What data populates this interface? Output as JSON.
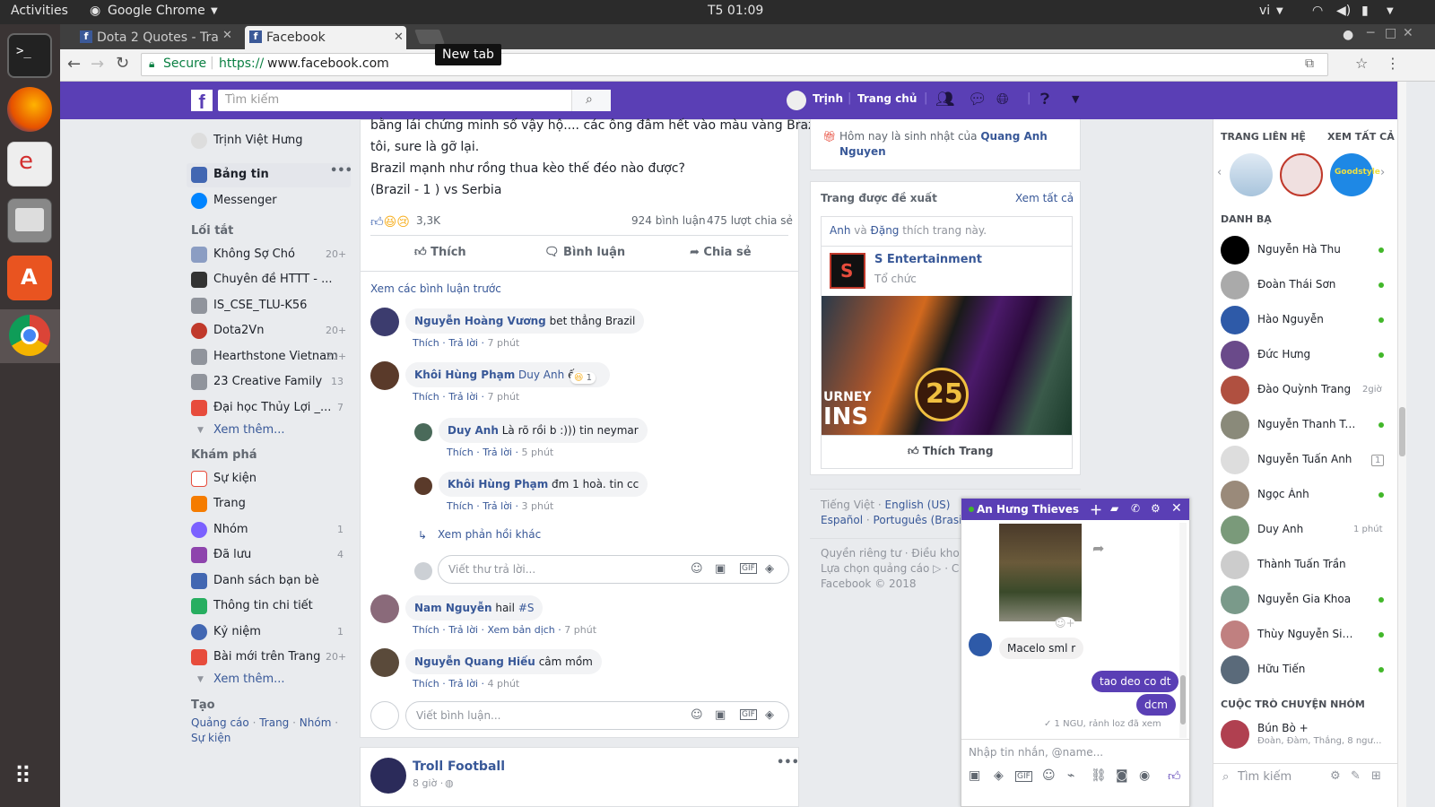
{
  "os": {
    "activities": "Activities",
    "app": "Google Chrome",
    "clock": "T5 01:09",
    "lang": "vi"
  },
  "chrome": {
    "tabs": [
      "Dota 2 Quotes - Tra",
      "Facebook"
    ],
    "new_tab_tooltip": "New tab",
    "secure": "Secure",
    "url_scheme": "https://",
    "url_host": "www.facebook.com"
  },
  "fb": {
    "search_placeholder": "Tìm kiếm",
    "user": "Trịnh",
    "home": "Trang chủ"
  },
  "left": {
    "profile": "Trịnh Việt Hưng",
    "news": "Bảng tin",
    "messenger": "Messenger",
    "shortcuts_title": "Lối tắt",
    "shortcuts": [
      {
        "label": "Không Sợ Chó",
        "count": "20+"
      },
      {
        "label": "Chuyên đề HTTT - ...",
        "count": ""
      },
      {
        "label": "IS_CSE_TLU-K56",
        "count": ""
      },
      {
        "label": "Dota2Vn",
        "count": "20+"
      },
      {
        "label": "Hearthstone Vietnam",
        "count": "20+"
      },
      {
        "label": "23 Creative Family",
        "count": "13"
      },
      {
        "label": "Đại học Thủy Lợi _...",
        "count": "7"
      }
    ],
    "see_more": "Xem thêm...",
    "explore_title": "Khám phá",
    "explore": [
      {
        "label": "Sự kiện",
        "count": ""
      },
      {
        "label": "Trang",
        "count": ""
      },
      {
        "label": "Nhóm",
        "count": "1"
      },
      {
        "label": "Đã lưu",
        "count": "4"
      },
      {
        "label": "Danh sách bạn bè",
        "count": ""
      },
      {
        "label": "Thông tin chi tiết",
        "count": ""
      },
      {
        "label": "Kỷ niệm",
        "count": "1"
      },
      {
        "label": "Bài mới trên Trang",
        "count": "20+"
      }
    ],
    "see_more2": "Xem thêm...",
    "create_title": "Tạo",
    "create_links": [
      "Quảng cáo",
      "Trang",
      "Nhóm",
      "Sự kiện"
    ],
    "sep": "·"
  },
  "post": {
    "text1": "bằng lái chứng minh số vậy hộ.... các ông đâm hết vào màu vàng Brazil cho",
    "text2": "tôi, sure là gỡ lại.",
    "text3": "Brazil mạnh như rồng thua kèo thế đéo nào được?",
    "text4": "(Brazil - 1 ) vs Serbia",
    "reactions": "3,3K",
    "comments": "924 bình luận",
    "shares": "475 lượt chia sẻ",
    "like": "Thích",
    "comment": "Bình luận",
    "share": "Chia sẻ",
    "prev_comments": "Xem các bình luận trước",
    "c1": {
      "name": "Nguyễn Hoàng Vương",
      "text": "bet thẳng Brazil",
      "like": "Thích",
      "reply": "Trả lời",
      "time": "7 phút"
    },
    "c2": {
      "name": "Khôi Hùng Phạm",
      "mention": "Duy Anh",
      "text": "ếu",
      "react": "1",
      "like": "Thích",
      "reply": "Trả lời",
      "time": "7 phút"
    },
    "r1": {
      "name": "Duy Anh",
      "text": "Là rõ rồi b :))) tin neymar",
      "like": "Thích",
      "reply": "Trả lời",
      "time": "5 phút"
    },
    "r2": {
      "name": "Khôi Hùng Phạm",
      "text": "đm 1 hoà. tin cc",
      "like": "Thích",
      "reply": "Trả lời",
      "time": "3 phút"
    },
    "more_replies": "Xem phản hồi khác",
    "reply_placeholder": "Viết thư trả lời...",
    "c3": {
      "name": "Nam Nguyễn",
      "text": "hail",
      "tag": "#S",
      "like": "Thích",
      "reply": "Trả lời",
      "translate": "Xem bản dịch",
      "time": "7 phút"
    },
    "c4": {
      "name": "Nguyễn Quang Hiếu",
      "text": "câm mồm",
      "like": "Thích",
      "reply": "Trả lời",
      "time": "4 phút"
    },
    "comment_placeholder": "Viết bình luận...",
    "next_page": "Troll Football",
    "next_time": "8 giờ ·"
  },
  "right": {
    "birthday": "Hôm nay là sinh nhật của",
    "birthday_name": "Quang Anh Nguyen",
    "suggested_title": "Trang được đề xuất",
    "see_all": "Xem tất cả",
    "liked_by_a": "Anh",
    "liked_by_and": "và",
    "liked_by_b": "Đặng",
    "liked_by_rest": "thích trang này.",
    "page_name": "S Entertainment",
    "page_type": "Tổ chức",
    "banner_text1": "URNEY",
    "banner_text2": "INS",
    "banner_num": "25",
    "like_page": "Thích Trang",
    "lang1": "Tiếng Việt",
    "lang2": "English (US)",
    "lang3": "Español",
    "lang4": "Português (Brasil",
    "footer1": "Quyền riêng tư · Điều khoản",
    "footer2": "Lựa chọn quảng cáo ▷ · Co",
    "footer3": "Facebook © 2018"
  },
  "contacts": {
    "pages_title": "TRANG LIÊN HỆ",
    "see_all": "XEM TẤT CẢ",
    "goodstyle": "Goodstyle",
    "list_title": "DANH BẠ",
    "people": [
      {
        "name": "Nguyễn Hà Thu",
        "status": "online",
        "time": ""
      },
      {
        "name": "Đoàn Thái Sơn",
        "status": "online",
        "time": ""
      },
      {
        "name": "Hào Nguyễn",
        "status": "online",
        "time": ""
      },
      {
        "name": "Đức Hưng",
        "status": "online",
        "time": ""
      },
      {
        "name": "Đào Quỳnh Trang",
        "status": "",
        "time": "2giờ"
      },
      {
        "name": "Nguyễn Thanh Tâm",
        "status": "online",
        "time": ""
      },
      {
        "name": "Nguyễn Tuấn Anh",
        "status": "",
        "time": "1"
      },
      {
        "name": "Ngọc Ánh",
        "status": "online",
        "time": ""
      },
      {
        "name": "Duy Anh",
        "status": "",
        "time": "1 phút"
      },
      {
        "name": "Thành Tuấn Trần",
        "status": "",
        "time": ""
      },
      {
        "name": "Nguyễn Gia Khoa",
        "status": "online",
        "time": ""
      },
      {
        "name": "Thùy Nguyễn SiNmo...",
        "status": "online",
        "time": ""
      },
      {
        "name": "Hữu Tiến",
        "status": "online",
        "time": ""
      }
    ],
    "groups_title": "CUỘC TRÒ CHUYỆN NHÓM",
    "group_name": "Bún Bò +",
    "group_members": "Đoàn, Đàm, Thắng, 8 ngư...",
    "search_placeholder": "Tìm kiếm"
  },
  "chat": {
    "title": "An Hưng Thieves",
    "msg1": "Macelo sml r",
    "msg2": "tao deo co dt",
    "msg3": "dcm",
    "seen": "✓ 1 NGU, rảnh loz đã xem",
    "input_placeholder": "Nhập tin nhắn, @name..."
  }
}
